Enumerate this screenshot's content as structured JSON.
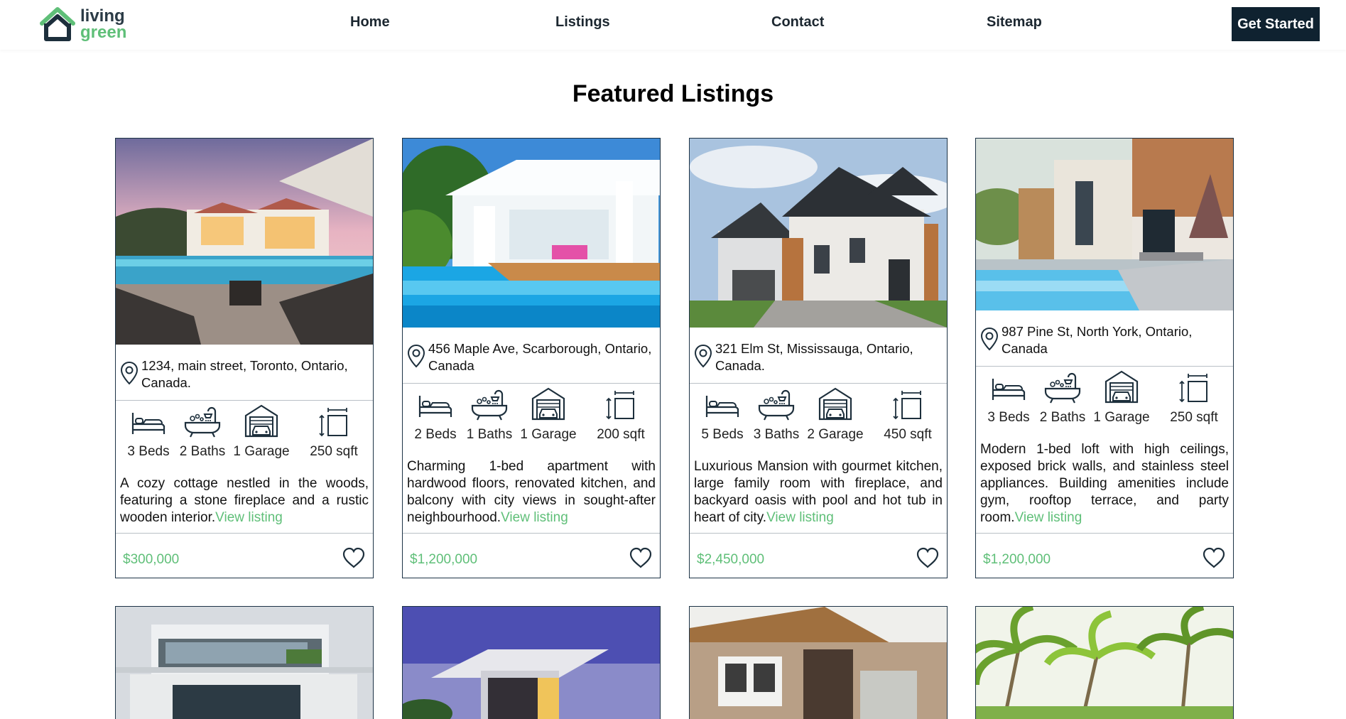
{
  "brand": {
    "line1": "living",
    "line2": "green",
    "accent": "#5fbf78",
    "dark": "#0f2230"
  },
  "nav": {
    "links": [
      "Home",
      "Listings",
      "Contact",
      "Sitemap"
    ],
    "cta": "Get Started"
  },
  "page_title": "Featured Listings",
  "listings": [
    {
      "address": "1234, main street, Toronto, Ontario, Canada.",
      "beds": "3 Beds",
      "baths": "2 Baths",
      "garage": "1 Garage",
      "area": "250 sqft",
      "description": "A cozy cottage nestled in the woods, featuring a stone fireplace and a rustic wooden interior.",
      "view_label": "View listing",
      "price": "$300,000",
      "image": "resort-pool-house"
    },
    {
      "address": "456 Maple Ave, Scarborough, Ontario, Canada",
      "beds": "2 Beds",
      "baths": "1 Baths",
      "garage": "1 Garage",
      "area": "200 sqft",
      "description": "Charming 1-bed apartment with hardwood floors, renovated kitchen, and balcony with city views in sought-after neighbourhood.",
      "view_label": "View listing",
      "price": "$1,200,000",
      "image": "white-pool-villa"
    },
    {
      "address": "321 Elm St, Mississauga, Ontario, Canada.",
      "beds": "5 Beds",
      "baths": "3 Baths",
      "garage": "2 Garage",
      "area": "450 sqft",
      "description": "Luxurious Mansion with gourmet kitchen, large family room with fireplace, and backyard oasis with pool and hot tub in heart of city.",
      "view_label": "View listing",
      "price": "$2,450,000",
      "image": "suburban-house"
    },
    {
      "address": "987 Pine St, North York, Ontario, Canada",
      "beds": "3 Beds",
      "baths": "2 Baths",
      "garage": "1 Garage",
      "area": "250 sqft",
      "description": "Modern 1-bed loft with high ceilings, exposed brick walls, and stainless steel appliances. Building amenities include gym, rooftop terrace, and party room.",
      "view_label": "View listing",
      "price": "$1,200,000",
      "image": "modern-pool-house"
    }
  ],
  "second_row_images": [
    "modern-glass-villa",
    "contemporary-house-dusk",
    "brick-townhouse",
    "palm-trees"
  ]
}
